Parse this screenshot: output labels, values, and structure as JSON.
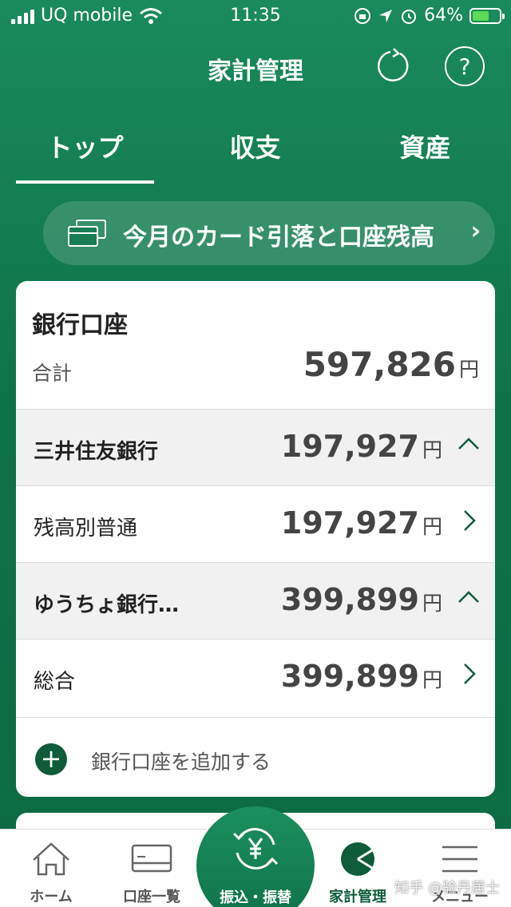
{
  "status_bar": {
    "carrier": "UQ mobile",
    "time": "11:35",
    "battery": "64%",
    "battery_level": 0.64
  },
  "header": {
    "title": "家計管理",
    "refresh_icon": "refresh-icon",
    "help_icon": "help-icon",
    "help_glyph": "?"
  },
  "tabs": [
    {
      "label": "トップ",
      "active": true
    },
    {
      "label": "収支",
      "active": false
    },
    {
      "label": "資産",
      "active": false
    }
  ],
  "banner": {
    "label": "今月のカード引落と口座残高",
    "chevron": "›"
  },
  "bank_card": {
    "title": "銀行口座",
    "total_label": "合計",
    "total_value": "597,826",
    "currency": "円",
    "rows": [
      {
        "type": "group",
        "label": "三井住友銀行",
        "value": "197,927",
        "currency": "円"
      },
      {
        "type": "account",
        "label": "残高別普通",
        "value": "197,927",
        "currency": "円"
      },
      {
        "type": "group",
        "label": "ゆうちょ銀行…",
        "value": "399,899",
        "currency": "円"
      },
      {
        "type": "account",
        "label": "総合",
        "value": "399,899",
        "currency": "円"
      }
    ],
    "add_label": "銀行口座を追加する",
    "add_glyph": "+"
  },
  "bottom_nav": [
    {
      "label": "ホーム",
      "icon": "home-icon"
    },
    {
      "label": "口座一覧",
      "icon": "card-icon"
    },
    {
      "label": "振込・振替",
      "icon": "yen-transfer-icon"
    },
    {
      "label": "家計管理",
      "icon": "pie-chart-icon",
      "active": true
    },
    {
      "label": "メニュー",
      "icon": "menu-icon"
    }
  ],
  "watermark": "知乎 @验丹居士",
  "colors": {
    "brand_green": "#0e7248",
    "dark_green": "#0e5c3a",
    "battery_green": "#5bdc52"
  }
}
